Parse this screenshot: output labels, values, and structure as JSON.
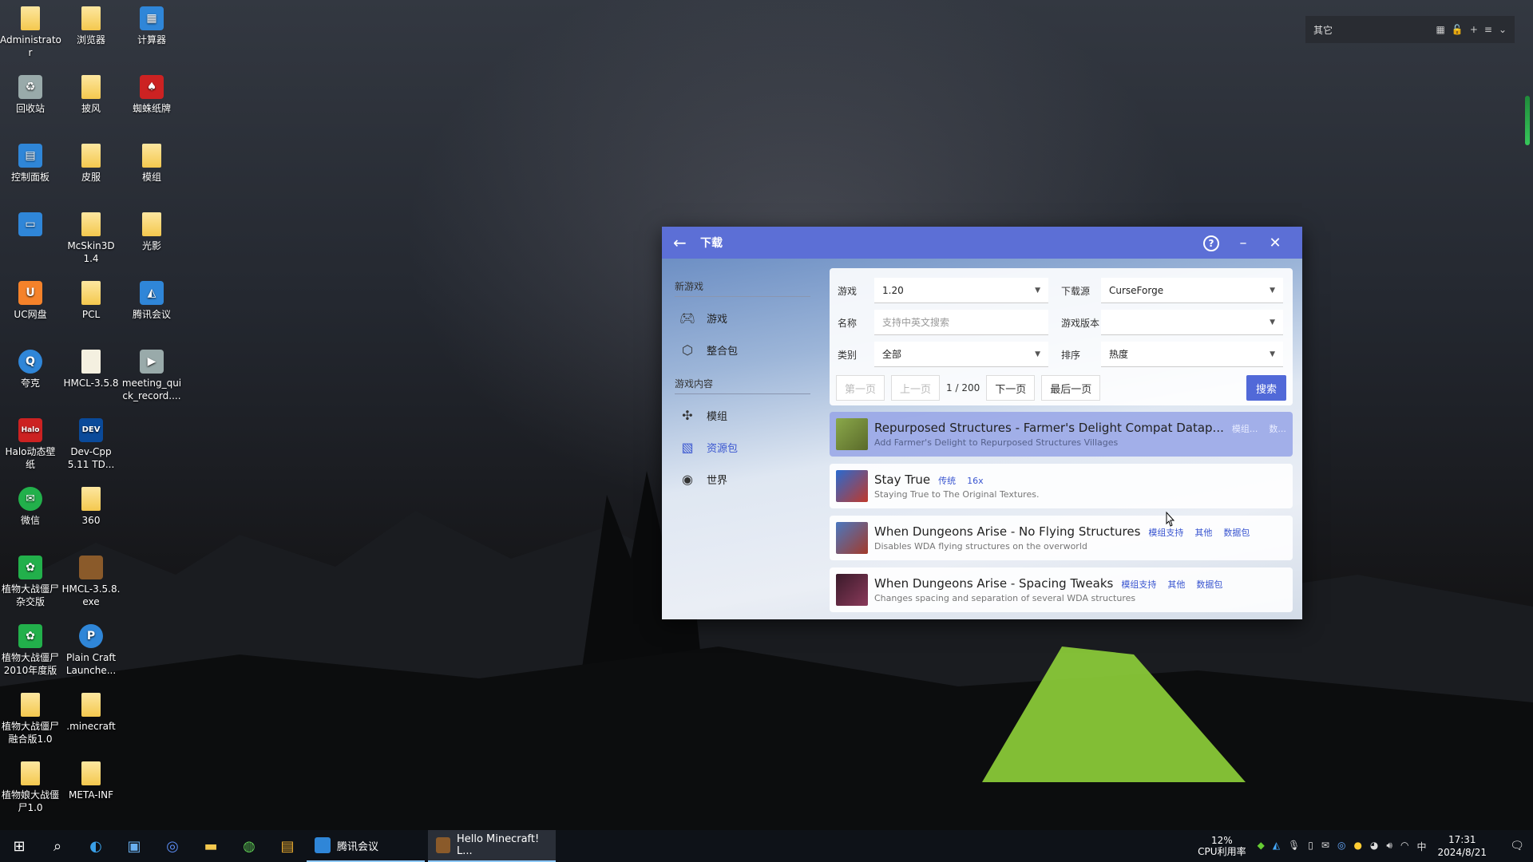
{
  "desktop_icons": [
    {
      "label": "Administrato\nr",
      "icon": "folder-icon"
    },
    {
      "label": "浏览器",
      "icon": "folder-icon"
    },
    {
      "label": "计算器",
      "icon": "calculator-icon"
    },
    {
      "label": "回收站",
      "icon": "recycle-bin-icon"
    },
    {
      "label": "披风",
      "icon": "folder-icon"
    },
    {
      "label": "蜘蛛纸牌",
      "icon": "spider-solitaire-icon"
    },
    {
      "label": "控制面板",
      "icon": "control-panel-icon"
    },
    {
      "label": "皮服",
      "icon": "folder-icon"
    },
    {
      "label": "模组",
      "icon": "folder-icon"
    },
    {
      "label": "",
      "icon": "computer-icon"
    },
    {
      "label": "McSkin3D\n1.4",
      "icon": "folder-icon"
    },
    {
      "label": "光影",
      "icon": "folder-icon"
    },
    {
      "label": "UC网盘",
      "icon": "uc-drive-icon"
    },
    {
      "label": "PCL",
      "icon": "folder-icon"
    },
    {
      "label": "腾讯会议",
      "icon": "tencent-meeting-icon"
    },
    {
      "label": "夸克",
      "icon": "quark-icon"
    },
    {
      "label": "HMCL-3.5.8",
      "icon": "file-icon"
    },
    {
      "label": "meeting_qui\nck_record....",
      "icon": "video-file-icon"
    },
    {
      "label": "Halo动态壁\n纸",
      "icon": "halo-icon"
    },
    {
      "label": "Dev-Cpp\n5.11 TD...",
      "icon": "dev-cpp-icon"
    },
    {
      "label": "微信",
      "icon": "wechat-icon"
    },
    {
      "label": "360",
      "icon": "folder-icon"
    },
    {
      "label": "植物大战僵尸\n杂交版",
      "icon": "pvz-icon"
    },
    {
      "label": "HMCL-3.5.8.\nexe",
      "icon": "minecraft-block-icon"
    },
    {
      "label": "植物大战僵尸\n2010年度版",
      "icon": "pvz-icon"
    },
    {
      "label": "Plain Craft\nLaunche...",
      "icon": "pcl-launcher-icon"
    },
    {
      "label": "植物大战僵尸\n融合版1.0",
      "icon": "folder-icon"
    },
    {
      "label": ".minecraft",
      "icon": "folder-icon"
    },
    {
      "label": "植物娘大战僵\n尸1.0",
      "icon": "folder-icon"
    },
    {
      "label": "META-INF",
      "icon": "folder-icon"
    }
  ],
  "top_panel": {
    "label": "其它"
  },
  "window": {
    "title": "下载",
    "sidebar": {
      "sections": [
        {
          "title": "新游戏",
          "items": [
            {
              "label": "游戏",
              "icon": "gamepad-icon"
            },
            {
              "label": "整合包",
              "icon": "package-icon"
            }
          ]
        },
        {
          "title": "游戏内容",
          "items": [
            {
              "label": "模组",
              "icon": "puzzle-icon"
            },
            {
              "label": "资源包",
              "icon": "resourcepack-icon",
              "active": true
            },
            {
              "label": "世界",
              "icon": "globe-icon"
            }
          ]
        }
      ]
    },
    "search": {
      "game_label": "游戏",
      "game_value": "1.20",
      "source_label": "下载源",
      "source_value": "CurseForge",
      "name_label": "名称",
      "name_placeholder": "支持中英文搜索",
      "version_label": "游戏版本",
      "version_value": "",
      "category_label": "类别",
      "category_value": "全部",
      "sort_label": "排序",
      "sort_value": "热度",
      "first_page": "第一页",
      "prev_page": "上一页",
      "page_info": "1 / 200",
      "next_page": "下一页",
      "last_page": "最后一页",
      "search_button": "搜索"
    },
    "results": [
      {
        "name": "Repurposed Structures - Farmer's Delight Compat Datap...",
        "tags": [
          "模组...",
          "数..."
        ],
        "desc": "Add Farmer's Delight to Repurposed Structures Villages",
        "color": "#6d8a3a",
        "highlighted": true
      },
      {
        "name": "Stay True",
        "tags": [
          "传统",
          "16x"
        ],
        "desc": "Staying True to The Original Textures.",
        "color": "#c0392b",
        "highlighted": false
      },
      {
        "name": "When Dungeons Arise - No Flying Structures",
        "tags": [
          "模组支持",
          "其他",
          "数据包"
        ],
        "desc": "Disables WDA flying structures on the overworld",
        "color": "#a33a2a",
        "highlighted": false
      },
      {
        "name": "When Dungeons Arise - Spacing Tweaks",
        "tags": [
          "模组支持",
          "其他",
          "数据包"
        ],
        "desc": "Changes spacing and separation of several WDA structures",
        "color": "#6a2a3a",
        "highlighted": false
      }
    ]
  },
  "taskbar": {
    "apps": [
      {
        "label": "腾讯会议"
      },
      {
        "label": "Hello Minecraft! L..."
      }
    ],
    "cpu_percent": "12%",
    "cpu_label": "CPU利用率",
    "ime": "中",
    "time": "17:31",
    "date": "2024/8/21"
  }
}
